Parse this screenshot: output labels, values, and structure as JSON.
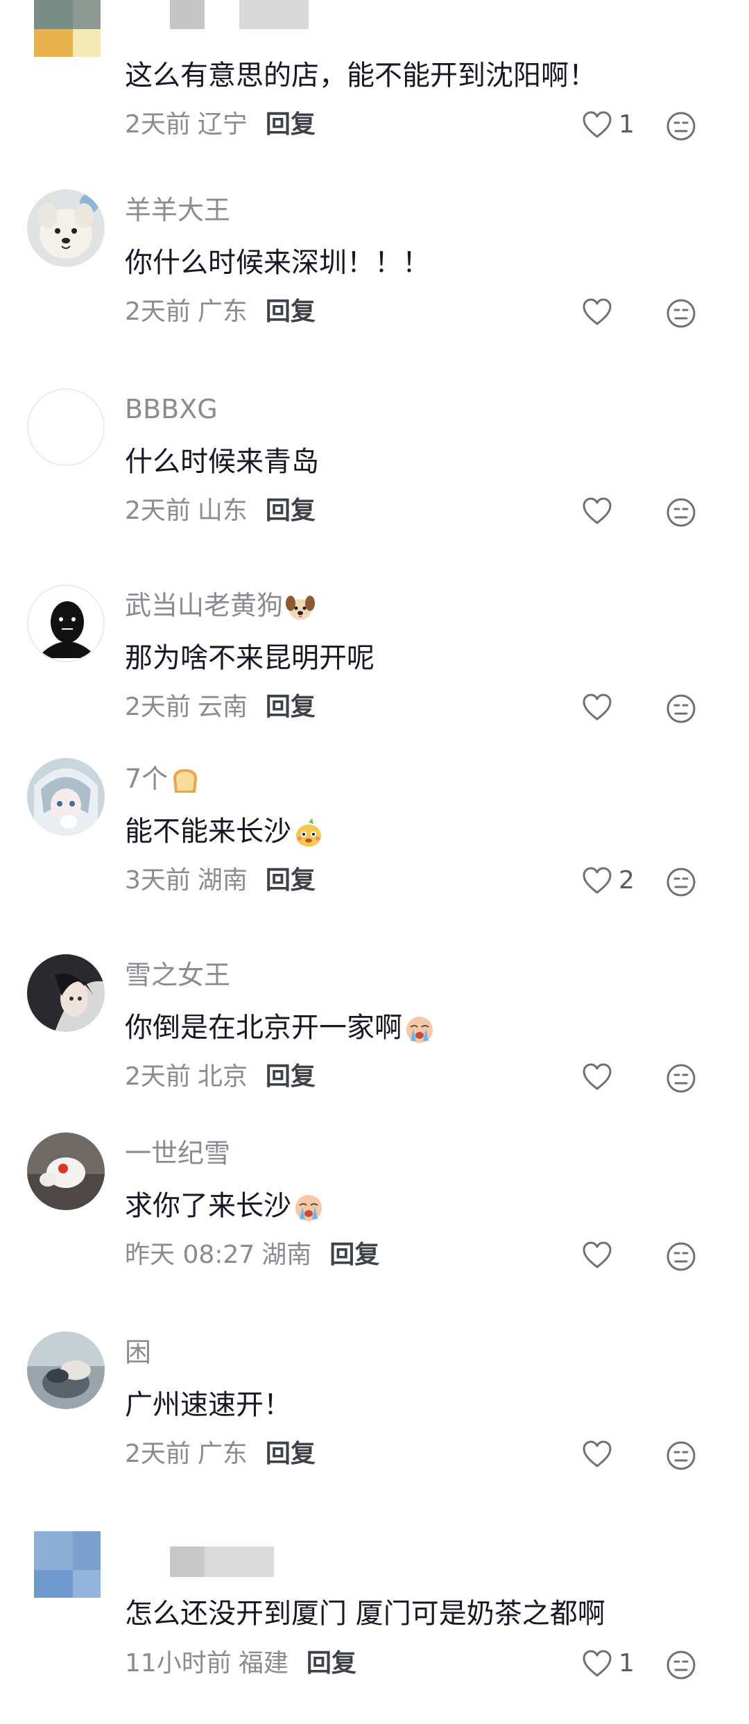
{
  "comments": [
    {
      "username": "",
      "text": "这么有意思的店，能不能开到沈阳啊！",
      "time": "2天前",
      "location": "辽宁",
      "reply": "回复",
      "likes": "1"
    },
    {
      "username": "羊羊大王",
      "text": "你什么时候来深圳！！！",
      "time": "2天前",
      "location": "广东",
      "reply": "回复",
      "likes": ""
    },
    {
      "username": "BBBXG",
      "text": "什么时候来青岛",
      "time": "2天前",
      "location": "山东",
      "reply": "回复",
      "likes": ""
    },
    {
      "username": "武当山老黄狗",
      "text": "那为啥不来昆明开呢",
      "time": "2天前",
      "location": "云南",
      "reply": "回复",
      "likes": ""
    },
    {
      "username": "7个",
      "text": "能不能来长沙",
      "time": "3天前",
      "location": "湖南",
      "reply": "回复",
      "likes": "2"
    },
    {
      "username": "雪之女王",
      "text": "你倒是在北京开一家啊",
      "time": "2天前",
      "location": "北京",
      "reply": "回复",
      "likes": ""
    },
    {
      "username": "一世纪雪",
      "text": "求你了来长沙",
      "time": "昨天 08:27",
      "location": "湖南",
      "reply": "回复",
      "likes": ""
    },
    {
      "username": "困",
      "text": "广州速速开！",
      "time": "2天前",
      "location": "广东",
      "reply": "回复",
      "likes": ""
    },
    {
      "username": "",
      "text": "怎么还没开到厦门 厦门可是奶茶之都啊",
      "time": "11小时前",
      "location": "福建",
      "reply": "回复",
      "likes": "1"
    }
  ],
  "icons": {
    "like": "heart-outline-icon",
    "dislike": "neutral-face-icon",
    "username_emoji_4": "dog-face-emoji",
    "username_emoji_5": "bread-emoji",
    "text_emoji_5": "cute-face-emoji",
    "text_emoji_6": "crying-face-emoji",
    "text_emoji_7": "crying-face-emoji"
  },
  "colors": {
    "username": "#8a8b91",
    "text": "#161823",
    "meta": "#8a8b91",
    "reply": "#3f4148",
    "background": "#ffffff"
  }
}
